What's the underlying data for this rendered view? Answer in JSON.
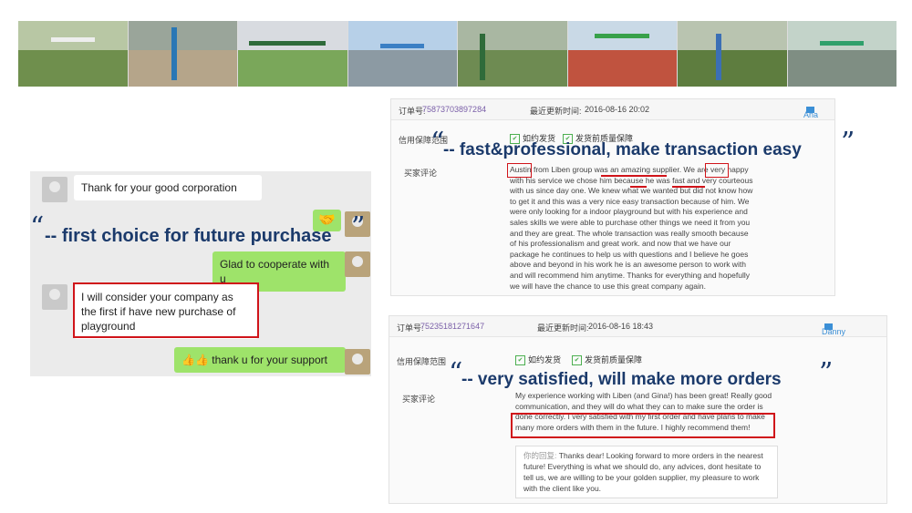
{
  "chat": {
    "msg1": "Thank for your good corporation",
    "emoji_bubble": "🤝",
    "msg2": "Glad to cooperate with u",
    "msg3": "I will consider your company as the first if have new purchase of playground",
    "msg4_emoji": "👍👍",
    "msg4_text": "thank u for your support"
  },
  "quotes": {
    "q1": "-- first choice for future purchase",
    "q2": "-- fast&professional, make transaction easy",
    "q3": "-- very satisfied, will make more orders",
    "open_mark": "“",
    "close_mark": "”"
  },
  "review1": {
    "order_label": "订单号:",
    "order_no": "75873703897284",
    "updated_label": "最近更新时间:",
    "updated_time": "2016-08-16 20:02",
    "user": "Ana",
    "guarantee_label": "信用保障范围",
    "tag1": "如约发货",
    "tag2": "发货前质量保障",
    "buyer_label": "买家评论",
    "text": "Austin from Liben group was an amazing supplier. We are very happy with his service we chose him because he was fast and very courteous with us since day one. We knew what we wanted but did not know how to get it and this was a very nice easy transaction because of him. We were only looking for a indoor playground but with his experience and sales skills we were able to purchase other things we need it from you and they are great. The whole transaction was really smooth because of his professionalism and great work. and now that we have our package he continues to help us with questions and I believe he goes above and beyond in his work he is an awesome person to work with and will recommend him anytime. Thanks for everything and hopefully we will have the chance to use this great company again."
  },
  "review2": {
    "order_label": "订单号:",
    "order_no": "75235181271647",
    "updated_label": "最近更新时间:",
    "updated_time": "2016-08-16 18:43",
    "user": "Danny",
    "guarantee_label": "信用保障范围",
    "tag1": "如约发货",
    "tag2": "发货前质量保障",
    "buyer_label": "买家评论",
    "text": "My experience working with Liben (and Gina!) has been great! Really good communication, and they will do what they can to make sure the order is done correctly. I very satisfied with my first order and have plans to make many more orders with them in the future. I highly recommend them!",
    "reply_label": "你的回复:",
    "reply": "Thanks dear! Looking forward to more orders in the nearest future! Everything is what we should do, any advices, dont hesitate to tell us, we are willing to be your golden supplier, my pleasure to work with the client like you."
  },
  "colors": {
    "quote": "#1b3a6b",
    "highlight": "#d0141a",
    "chat_green": "#9ee36a",
    "order_no": "#7a5fa8"
  }
}
